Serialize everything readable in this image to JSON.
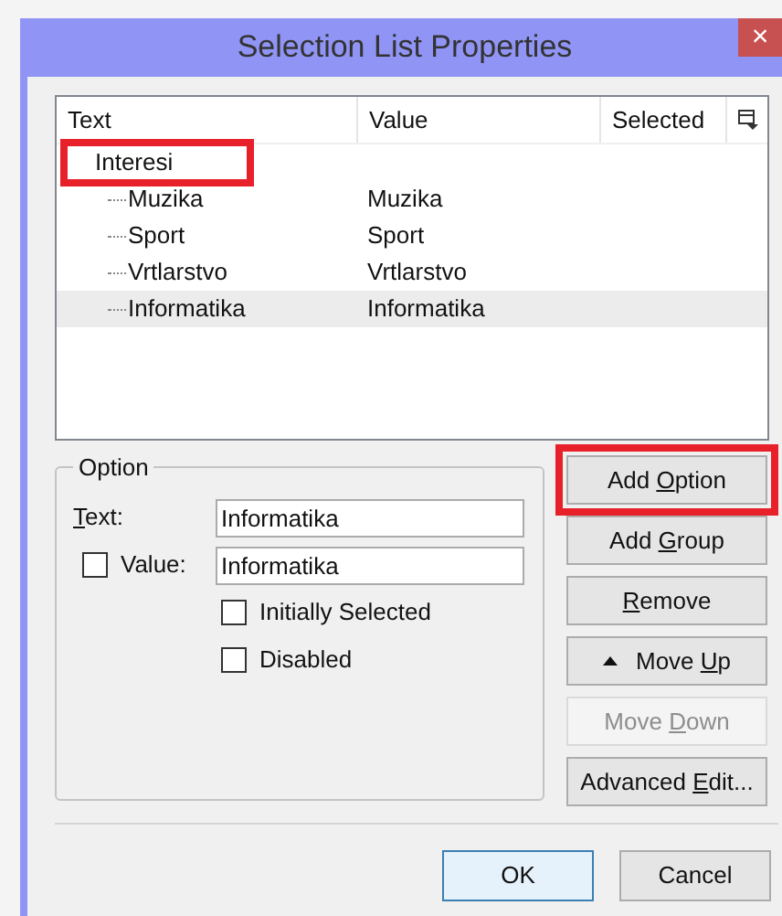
{
  "window": {
    "title": "Selection List Properties",
    "close": "×"
  },
  "list": {
    "columns": [
      "Text",
      "Value",
      "Selected"
    ],
    "groups": [
      {
        "text": "Interesi",
        "highlighted": true,
        "children": [
          {
            "text": "Muzika",
            "value": "Muzika",
            "selected": false
          },
          {
            "text": "Sport",
            "value": "Sport",
            "selected": false
          },
          {
            "text": "Vrtlarstvo",
            "value": "Vrtlarstvo",
            "selected": false
          },
          {
            "text": "Informatika",
            "value": "Informatika",
            "selected": true
          }
        ]
      }
    ]
  },
  "option": {
    "title": "Option",
    "text_label": {
      "key": "T",
      "after": "ext:"
    },
    "text_value": "Informatika",
    "value_label": "Value:",
    "value_checked": false,
    "value_value": "Informatika",
    "checks": [
      {
        "label": "Initially Selected",
        "checked": false
      },
      {
        "label": "Disabled",
        "checked": false
      }
    ]
  },
  "buttons": [
    {
      "before": "Add ",
      "key": "O",
      "after": "ption",
      "disabled": false,
      "highlighted": true,
      "kind": "plain"
    },
    {
      "before": "Add ",
      "key": "G",
      "after": "roup",
      "disabled": false,
      "highlighted": false,
      "kind": "plain"
    },
    {
      "key": "R",
      "after": "emove",
      "disabled": false,
      "highlighted": false,
      "kind": "plain"
    },
    {
      "before": "Move ",
      "key": "U",
      "after": "p",
      "disabled": false,
      "highlighted": false,
      "kind": "up"
    },
    {
      "before": "Move ",
      "key": "D",
      "after": "own",
      "disabled": true,
      "highlighted": false,
      "kind": "plain"
    },
    {
      "before": "Advanced ",
      "key": "E",
      "after": "dit...",
      "disabled": false,
      "highlighted": false,
      "kind": "plain"
    }
  ],
  "footer": [
    {
      "label": "OK",
      "default": true
    },
    {
      "label": "Cancel",
      "default": false
    }
  ]
}
